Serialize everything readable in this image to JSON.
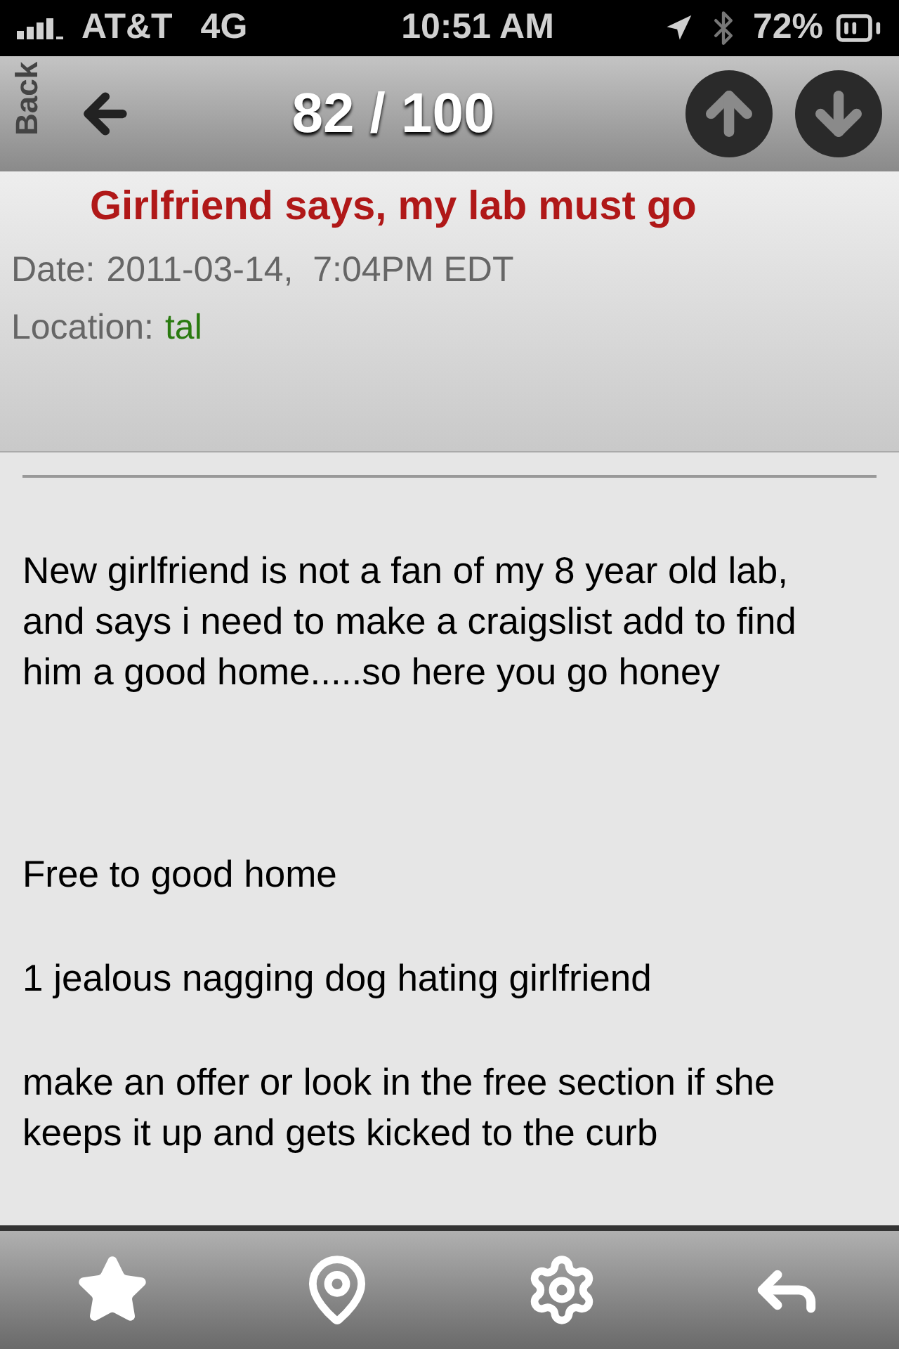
{
  "status_bar": {
    "carrier": "AT&T",
    "network": "4G",
    "time": "10:51 AM",
    "battery": "72%"
  },
  "nav": {
    "back": "Back",
    "counter": "82 / 100"
  },
  "post": {
    "title": "Girlfriend says, my lab must go",
    "date_label": "Date:",
    "date": "2011-03-14,  7:04PM EDT",
    "location_label": "Location:",
    "location": "tal"
  },
  "body": [
    "New girlfriend is not a fan of my 8 year old lab, and says i need to make a craigslist add to find him a good home.....so here you go honey",
    "Free to good home",
    "1 jealous nagging dog hating girlfriend",
    "make an offer or look in the free section if she keeps it up and gets kicked to the curb"
  ]
}
